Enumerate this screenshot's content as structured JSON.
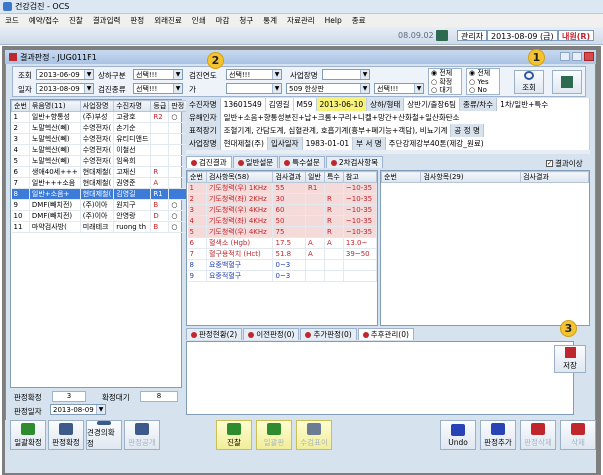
{
  "window": {
    "title": "건강검진 - OCS"
  },
  "menu": [
    "코드",
    "예약/접수",
    "진찰",
    "결과입력",
    "판정",
    "외래진료",
    "인쇄",
    "마감",
    "청구",
    "통계",
    "자료관리",
    "Help",
    "종료"
  ],
  "toolbar": {
    "date": "08.09.02",
    "role": "관리자",
    "datetime": "2013-08-09 (금)",
    "user": "내원(R)"
  },
  "child": {
    "title": "결과판정 - JUG011F1"
  },
  "filter": {
    "jo": "조회",
    "jo_date": "2013-06-09",
    "sanghwa_label": "상하구분",
    "sanghwa_val": "선택!!!",
    "geomjin_yeon_label": "검진연도",
    "geomjin_yeon_val": "선택!!!",
    "saeop_label": "사업장명",
    "il": "일자",
    "il_date": "2013-08-09",
    "geomjin_jong_label": "검진종류",
    "geomjin_jong_val": "선택!!!",
    "ga_label": "가",
    "company_val": "509 한상판",
    "last_val": "선택!!!",
    "radio1": [
      "전체",
      "확정",
      "대기"
    ],
    "radio2": [
      "전체",
      "Yes",
      "No"
    ],
    "search_label": "조회"
  },
  "left_grid": {
    "headers": [
      "순번",
      "묶음명(11)",
      "사업장명",
      "수진자명",
      "등급",
      "판정"
    ],
    "rows": [
      [
        "1",
        "일반+향통성",
        "(주)부성",
        "고광호",
        "R2",
        "○"
      ],
      [
        "2",
        "노말헥산(뻬)",
        "수영전자(",
        "손기순",
        "",
        ""
      ],
      [
        "3",
        "노말헥산(뻬)",
        "수영전자(",
        "유티디앤드",
        "",
        ""
      ],
      [
        "4",
        "노말헥산(뻬)",
        "수영전자(",
        "이철선",
        "",
        ""
      ],
      [
        "5",
        "노말헥산(뻬)",
        "수영전자(",
        "임옥희",
        "",
        ""
      ],
      [
        "6",
        "생애40세+++",
        "현대제철(",
        "고재신",
        "R",
        ""
      ],
      [
        "7",
        "일반+++소음",
        "현대제철(",
        "권영준",
        "A",
        ""
      ],
      [
        "8",
        "일반+소음+",
        "현대제철(",
        "김영길",
        "R1",
        ""
      ],
      [
        "9",
        "DMF(빼치전)",
        "(주)이아",
        "원지구",
        "B",
        "○"
      ],
      [
        "10",
        "DMF(빼치전)",
        "(주)이아",
        "안영랑",
        "D",
        "○"
      ],
      [
        "11",
        "마약검사방(",
        "미래테크",
        "ruong th",
        "B",
        "○"
      ]
    ],
    "selected_index": 7
  },
  "left_footer": {
    "confirm_label": "판정확정",
    "confirm_val": "3",
    "wait_label": "확정대기",
    "wait_val": "8",
    "date_label": "판정일자",
    "date_val": "2013-08-09"
  },
  "info": {
    "rows": [
      [
        [
          "수진자명",
          "13601549"
        ],
        [
          "김영길",
          ""
        ],
        [
          "M",
          "59"
        ],
        [
          "2013-06-10",
          ""
        ],
        [
          "상하/형태",
          "상반기/출장6팀"
        ],
        [
          "종류/차수",
          "1차/일반+특수"
        ]
      ],
      [
        [
          "유해인자",
          "일반+소음+향통성분진+납+크롬+구리+니켈+망간+산화철+일산화탄소"
        ]
      ],
      [
        [
          "표적장기",
          "조혈기계, 간담도계, 심혈관계, 호흡기계(흉부+폐기능+객담), 비뇨기계"
        ],
        [
          "공 정 명",
          ""
        ]
      ],
      [
        [
          "사업장명",
          "현대제철(주)"
        ],
        [
          "입사일자",
          "1983-01-01"
        ],
        [
          "부 서 명",
          "주단강제강부40톤(제강_원료)"
        ]
      ]
    ]
  },
  "result_tabs": [
    "검진결과",
    "일반설문",
    "특수설문",
    "2차검사항목"
  ],
  "result_check": "결과이상",
  "result_grid": {
    "headers": [
      "순번",
      "검사항목(58)",
      "검사결과",
      "일반",
      "특수",
      "참고"
    ],
    "rows": [
      [
        "1",
        "기도청력(우) 1KHz",
        "55",
        "R1",
        "",
        "~10-35"
      ],
      [
        "2",
        "기도청력(좌) 2KHz",
        "30",
        "",
        "R",
        "~10-35"
      ],
      [
        "3",
        "기도청력(우) 4KHz",
        "60",
        "",
        "R",
        "~10-35"
      ],
      [
        "4",
        "기도청력(좌) 4KHz",
        "50",
        "",
        "R",
        "~10-35"
      ],
      [
        "5",
        "기도청력(우) 4KHz",
        "75",
        "",
        "R",
        "~10-35"
      ],
      [
        "6",
        "혈색소 (Hgb)",
        "17.5",
        "A",
        "A",
        "13.0~"
      ],
      [
        "7",
        "혈구용적치 (Hct)",
        "51.8",
        "A",
        "",
        "39~50"
      ],
      [
        "8",
        "요중백혈구",
        "0~3",
        "",
        "",
        ""
      ],
      [
        "9",
        "요중적혈구",
        "0~3",
        "",
        "",
        ""
      ]
    ]
  },
  "second_grid": {
    "headers": [
      "순번",
      "검사항목(29)",
      "검사결과"
    ]
  },
  "judge_tabs": [
    "판정현황(2)",
    "이전판정(0)",
    "추가판정(0)",
    "추후관리(0)"
  ],
  "save_label": "저장",
  "bottom_buttons": [
    {
      "label": "일괄확정",
      "icon": "check-icon"
    },
    {
      "label": "판정확정",
      "icon": "doctor-icon"
    },
    {
      "label": "견경의확정",
      "icon": "doctor-icon"
    },
    {
      "label": "판정공개",
      "icon": "doctor-icon"
    },
    {
      "label": "진찰",
      "icon": "refresh-icon"
    },
    {
      "label": "일괄판",
      "icon": "refresh-icon"
    },
    {
      "label": "수검표이",
      "icon": "doc-icon"
    },
    {
      "label": "Undo",
      "icon": "undo-icon"
    },
    {
      "label": "판정추가",
      "icon": "add-icon"
    },
    {
      "label": "판정삭제",
      "icon": "delete-icon"
    },
    {
      "label": "삭제",
      "icon": "delete-icon"
    }
  ],
  "badges": [
    "1",
    "2",
    "3"
  ]
}
